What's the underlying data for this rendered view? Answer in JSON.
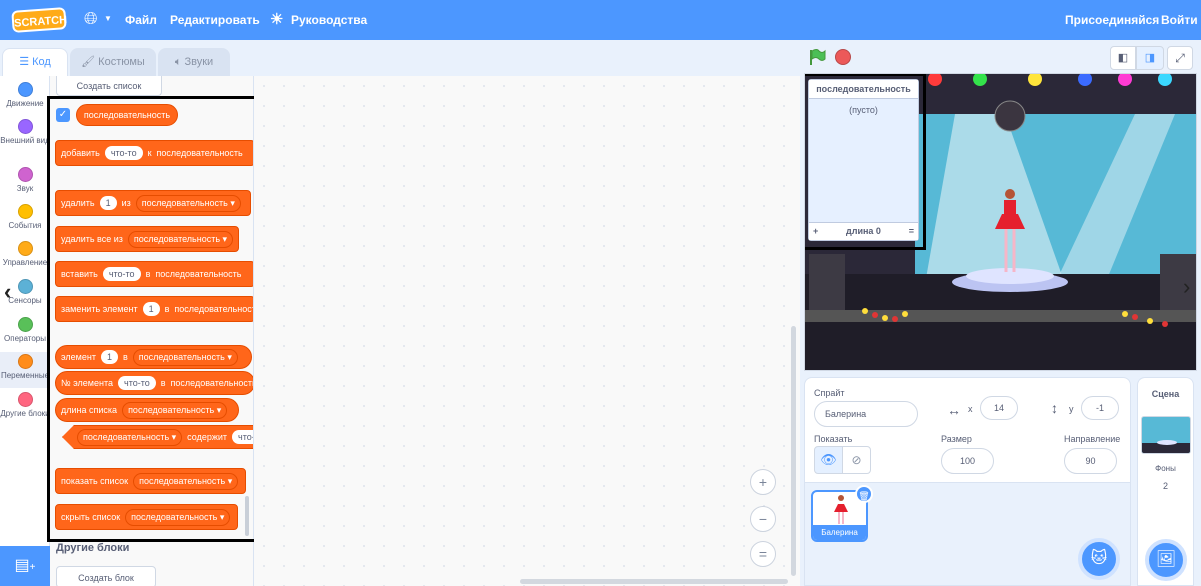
{
  "menu": {
    "logo": "SCRATCH",
    "file": "Файл",
    "edit": "Редактировать",
    "tutorials": "Руководства",
    "join": "Присоединяйся",
    "signin": "Войти"
  },
  "tabs": {
    "code": "Код",
    "costumes": "Костюмы",
    "sounds": "Звуки"
  },
  "categories": [
    {
      "label": "Движение",
      "color": "#4c97ff"
    },
    {
      "label": "Внешний вид",
      "color": "#9966ff"
    },
    {
      "label": "Звук",
      "color": "#cf63cf"
    },
    {
      "label": "События",
      "color": "#ffbf00"
    },
    {
      "label": "Управление",
      "color": "#ffab19"
    },
    {
      "label": "Сенсоры",
      "color": "#5cb1d6"
    },
    {
      "label": "Операторы",
      "color": "#59c059"
    },
    {
      "label": "Переменные",
      "color": "#ff8c1a"
    },
    {
      "label": "Другие блоки",
      "color": "#ff6680"
    }
  ],
  "palette": {
    "make_list": "Создать список",
    "list_name": "последовательность",
    "b_add": "добавить",
    "thing": "что-то",
    "b_to": "к",
    "b_delete": "удалить",
    "one": "1",
    "b_of": "из",
    "b_delete_all": "удалить все из",
    "b_insert": "вставить",
    "b_at": "в",
    "b_replace": "заменить элемент",
    "b_item": "элемент",
    "b_item_num": "№ элемента",
    "b_length": "длина списка",
    "b_contains": "содержит",
    "b_show": "показать список",
    "b_hide": "скрыть список",
    "more_blocks": "Другие блоки",
    "make_block": "Создать блок"
  },
  "zoom": {
    "in": "+",
    "out": "−",
    "reset": "="
  },
  "stage": {
    "monitor_title": "последовательность",
    "monitor_empty": "(пусто)",
    "monitor_add": "+",
    "monitor_length": "длина 0",
    "monitor_resize": "="
  },
  "sprite": {
    "label": "Спрайт",
    "name": "Балерина",
    "x_label": "x",
    "x": "14",
    "y_label": "y",
    "y": "-1",
    "show_label": "Показать",
    "size_label": "Размер",
    "size": "100",
    "direction_label": "Направление",
    "direction": "90",
    "thumb_name": "Балерина"
  },
  "scene": {
    "title": "Сцена",
    "backdrops_label": "Фоны",
    "backdrops": "2"
  }
}
